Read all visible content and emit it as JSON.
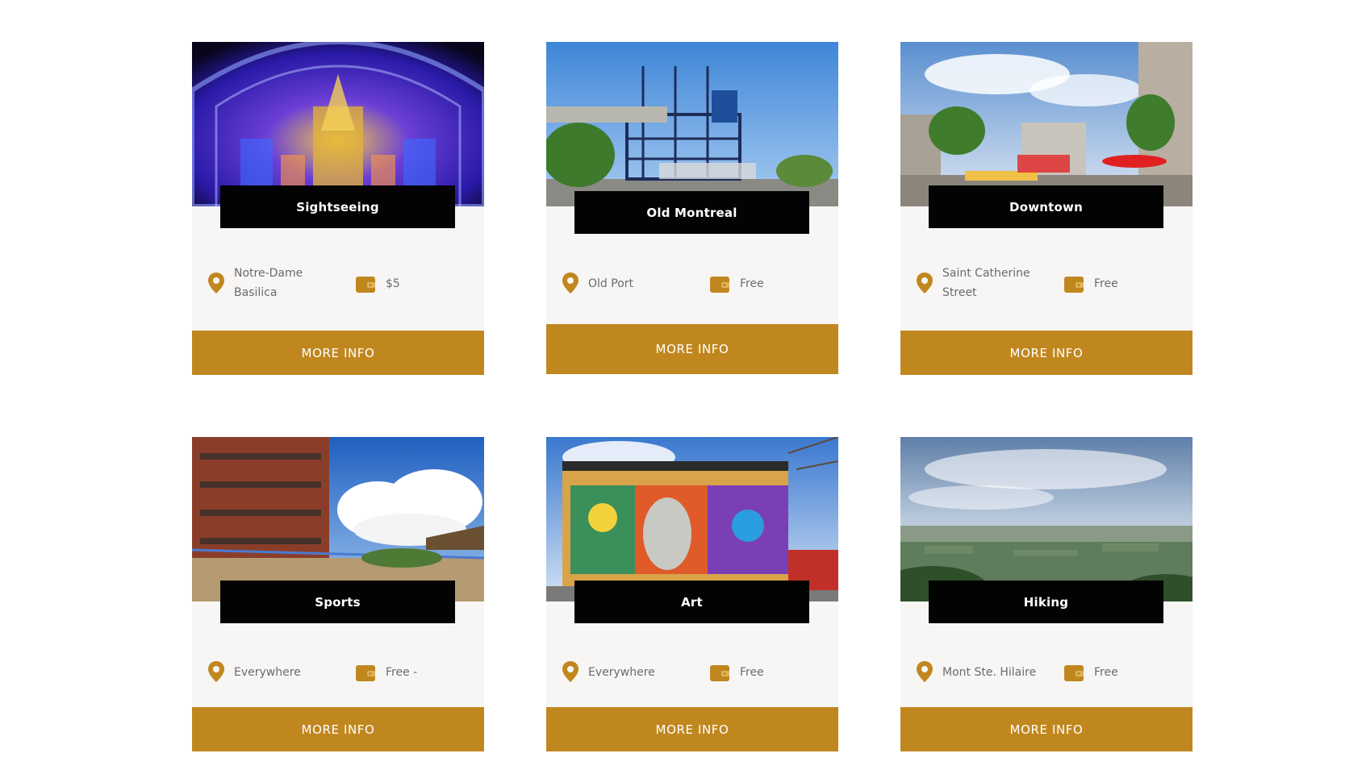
{
  "accent_color": "#c1871f",
  "title_bg_color": "#030303",
  "card_bg_color": "#f7f6f4",
  "cards": [
    {
      "title": "Sightseeing",
      "image": "notre-dame-basilica-interior-photo",
      "location": "Notre-Dame Basilica",
      "price": "$5",
      "button": "MORE INFO",
      "location_icon": "map-pin-icon",
      "price_icon": "wallet-icon"
    },
    {
      "title": "Old Montreal",
      "image": "old-port-photo",
      "location": "Old Port",
      "price": "Free",
      "button": "MORE INFO",
      "location_icon": "map-pin-icon",
      "price_icon": "wallet-icon"
    },
    {
      "title": "Downtown",
      "image": "saint-catherine-street-photo",
      "location": "Saint Catherine Street",
      "price": "Free",
      "button": "MORE INFO",
      "location_icon": "map-pin-icon",
      "price_icon": "wallet-icon"
    },
    {
      "title": "Sports",
      "image": "beach-volleyball-court-photo",
      "location": "Everywhere",
      "price": "Free -",
      "button": "MORE INFO",
      "location_icon": "map-pin-icon",
      "price_icon": "wallet-icon"
    },
    {
      "title": "Art",
      "image": "street-mural-building-photo",
      "location": "Everywhere",
      "price": "Free",
      "button": "MORE INFO",
      "location_icon": "map-pin-icon",
      "price_icon": "wallet-icon"
    },
    {
      "title": "Hiking",
      "image": "mountain-view-landscape-photo",
      "location": "Mont Ste. Hilaire",
      "price": "Free",
      "button": "MORE INFO",
      "location_icon": "map-pin-icon",
      "price_icon": "wallet-icon"
    }
  ]
}
